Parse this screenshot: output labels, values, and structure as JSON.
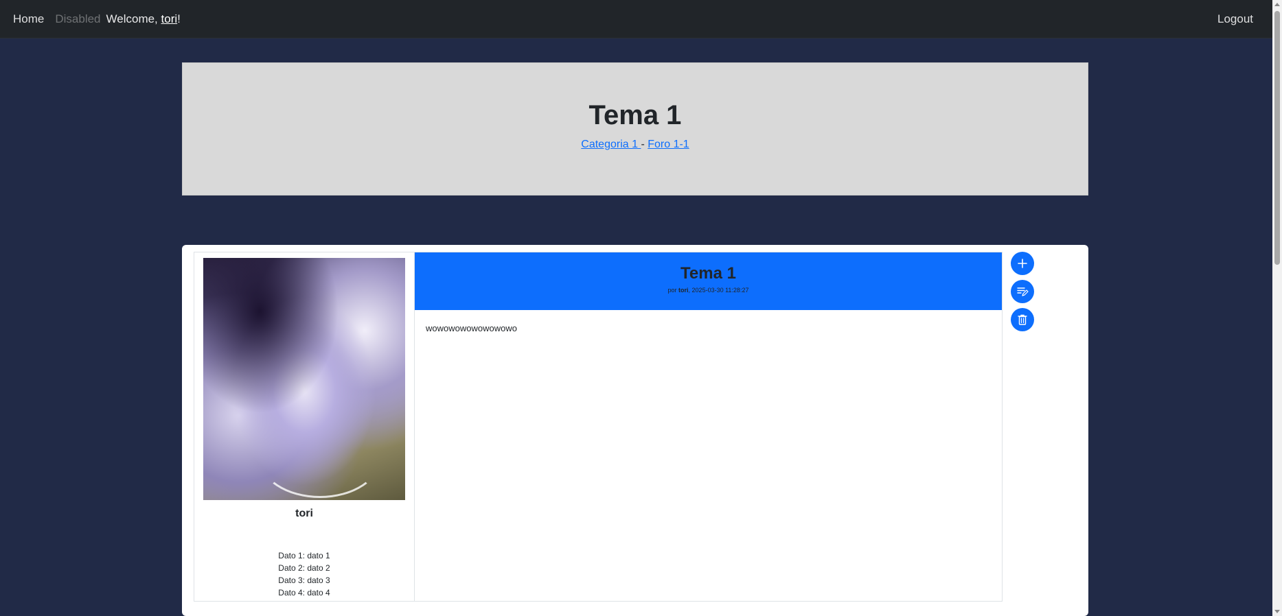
{
  "navbar": {
    "home": "Home",
    "disabled": "Disabled",
    "welcome_prefix": "Welcome, ",
    "username": "tori",
    "welcome_suffix": "!",
    "logout": "Logout"
  },
  "topic": {
    "title": "Tema 1",
    "breadcrumb": {
      "category": "Categoria 1 ",
      "separator": " - ",
      "forum": "Foro 1-1"
    }
  },
  "post": {
    "author": {
      "name": "tori",
      "data": [
        "Dato 1: dato 1",
        "Dato 2: dato 2",
        "Dato 3: dato 3",
        "Dato 4: dato 4"
      ]
    },
    "title": "Tema 1",
    "meta_prefix": "por ",
    "meta_author": "tori",
    "meta_date": ", 2025-03-30 11:28:27",
    "body": "wowowowowowowowo"
  },
  "actions": {
    "icons": [
      "plus-icon",
      "edit-icon",
      "trash-icon"
    ]
  },
  "colors": {
    "page_bg": "#212a47",
    "navbar_bg": "#212529",
    "accent": "#0d6efd",
    "header_bg": "#d9d9d9"
  }
}
